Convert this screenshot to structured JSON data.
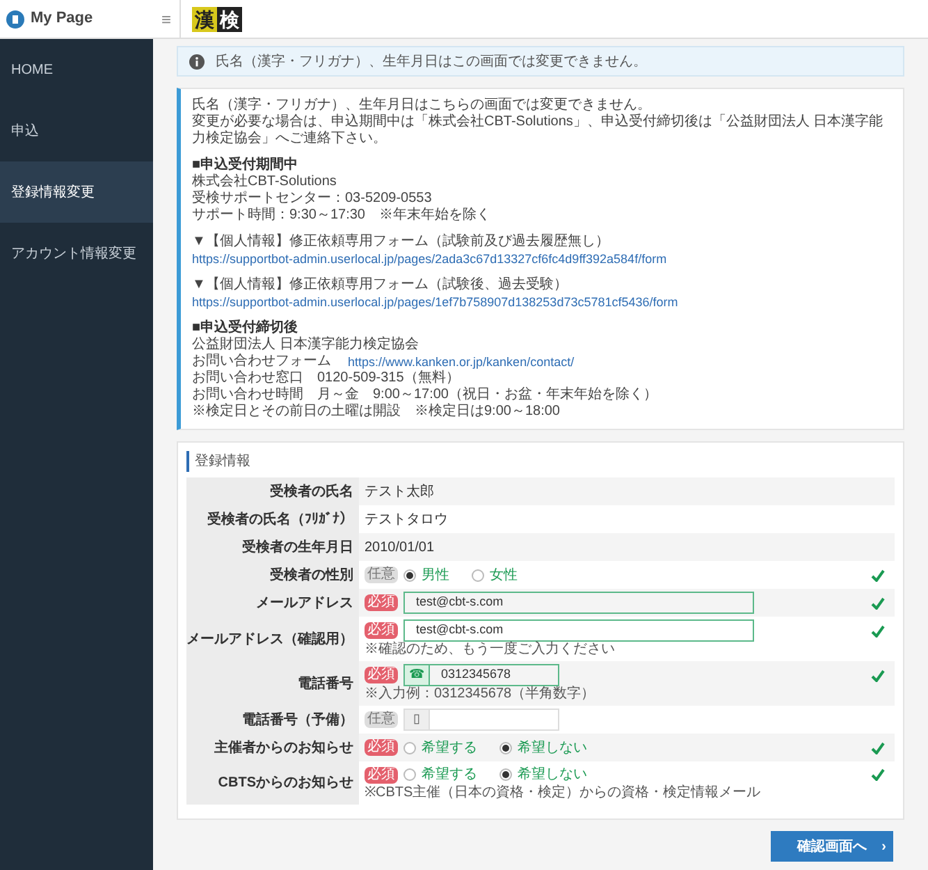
{
  "sidebar": {
    "title": "My Page",
    "items": [
      {
        "label": "HOME",
        "selected": false
      },
      {
        "label": "申込",
        "selected": false
      },
      {
        "label": "登録情報変更",
        "selected": true
      },
      {
        "label": "アカウント情報変更",
        "selected": false
      }
    ]
  },
  "header": {
    "menu_glyph": "≡",
    "logo": [
      "漢",
      "検"
    ]
  },
  "alert": {
    "text": "氏名（漢字・フリガナ）、生年月日はこの画面では変更できません。"
  },
  "notice": {
    "paragraphs": [
      [
        {
          "kind": "text",
          "text": "氏名（漢字・フリガナ）、生年月日はこちらの画面では変更できません。"
        },
        {
          "kind": "text",
          "text": "変更が必要な場合は、申込期間中は「株式会社CBT-Solutions」、申込受付締切後は「公益財団法人 日本漢字能力検定協会」へご連絡下さい。"
        }
      ],
      [
        {
          "kind": "heading",
          "text": "■申込受付期間中"
        },
        {
          "kind": "text",
          "text": "株式会社CBT-Solutions"
        },
        {
          "kind": "text",
          "text": "受検サポートセンター：03-5209-0553"
        },
        {
          "kind": "text",
          "text": "サポート時間：9:30～17:30　※年末年始を除く"
        }
      ],
      [
        {
          "kind": "text",
          "text": "▼【個人情報】修正依頼専用フォーム（試験前及び過去履歴無し）"
        },
        {
          "kind": "link",
          "text": "https://supportbot-admin.userlocal.jp/pages/2ada3c67d13327cf6fc4d9ff392a584f/form"
        }
      ],
      [
        {
          "kind": "text",
          "text": "▼【個人情報】修正依頼専用フォーム（試験後、過去受験）"
        },
        {
          "kind": "link",
          "text": "https://supportbot-admin.userlocal.jp/pages/1ef7b758907d138253d73c5781cf5436/form"
        }
      ],
      [
        {
          "kind": "heading",
          "text": "■申込受付締切後"
        },
        {
          "kind": "text",
          "text": "公益財団法人 日本漢字能力検定協会"
        },
        {
          "kind": "labeled_link",
          "text": "お問い合わせフォーム",
          "url": "https://www.kanken.or.jp/kanken/contact/"
        },
        {
          "kind": "text",
          "text": "お問い合わせ窓口　0120-509-315（無料）"
        },
        {
          "kind": "text",
          "text": "お問い合わせ時間　月～金　9:00～17:00（祝日・お盆・年末年始を除く）"
        },
        {
          "kind": "text",
          "text": "※検定日とその前日の土曜は開設　※検定日は9:00～18:00"
        }
      ]
    ]
  },
  "form": {
    "title": "登録情報",
    "rows": [
      {
        "label": "受検者の氏名",
        "kind": "text",
        "value": "テスト太郎"
      },
      {
        "label": "受検者の氏名（ﾌﾘｶﾞﾅ）",
        "kind": "text",
        "value": "テストタロウ"
      },
      {
        "label": "受検者の生年月日",
        "kind": "text",
        "value": "2010/01/01"
      },
      {
        "label": "受検者の性別",
        "kind": "radio",
        "badge": "任意",
        "required": false,
        "valid": true,
        "options": [
          {
            "label": "男性",
            "selected": true
          },
          {
            "label": "女性",
            "selected": false
          }
        ]
      },
      {
        "label": "メールアドレス",
        "kind": "input",
        "badge": "必須",
        "required": true,
        "valid": true,
        "value": "test@cbt-s.com"
      },
      {
        "label": "メールアドレス（確認用）",
        "kind": "input",
        "badge": "必須",
        "required": true,
        "valid": true,
        "value": "test@cbt-s.com",
        "note": "※確認のため、もう一度ご入力ください"
      },
      {
        "label": "電話番号",
        "kind": "phone",
        "badge": "必須",
        "required": true,
        "valid": true,
        "prefix": "☎",
        "value": "0312345678",
        "note": "※入力例：0312345678（半角数字）"
      },
      {
        "label": "電話番号（予備）",
        "kind": "phone",
        "badge": "任意",
        "required": false,
        "valid": false,
        "prefix": "▯"
      },
      {
        "label": "主催者からのお知らせ",
        "kind": "radio",
        "badge": "必須",
        "required": true,
        "valid": true,
        "options": [
          {
            "label": "希望する",
            "selected": false
          },
          {
            "label": "希望しない",
            "selected": true
          }
        ]
      },
      {
        "label": "CBTSからのお知らせ",
        "kind": "radio",
        "badge": "必須",
        "required": true,
        "valid": true,
        "options": [
          {
            "label": "希望する",
            "selected": false
          },
          {
            "label": "希望しない",
            "selected": true
          }
        ],
        "note": "※CBTS主催（日本の資格・検定）からの資格・検定情報メール"
      }
    ]
  },
  "submit": {
    "label": "確認画面へ",
    "chevron": "›"
  }
}
